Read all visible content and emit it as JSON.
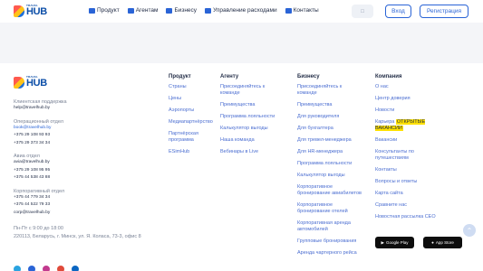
{
  "header": {
    "logo_small": "TRAVEL",
    "logo_big": "HUB",
    "nav": [
      "Продукт",
      "Агентам",
      "Бизнесу",
      "Управление расходами",
      "Контакты"
    ],
    "login": "Вход",
    "register": "Регистрация"
  },
  "contacts": {
    "support_label": "Клиентская поддержка",
    "support_email": "help@travelhub.by",
    "ops_label": "Операционный отдел",
    "ops_email": "book@travelhub.by",
    "ops_phone1": "+375 29 108 93 93",
    "ops_phone2": "+375 29 373 34 34",
    "avia_label": "Авиа отдел",
    "avia_email": "avia@travelhub.by",
    "avia_phone1": "+375 29 108 95 95",
    "avia_phone2": "+375 44 538 43 88",
    "corp_label": "Корпоративный отдел",
    "corp_phone1": "+375 44 779 34 34",
    "corp_phone2": "+375 44 522 79 33",
    "corp_email": "corp@travelhub.by",
    "hours": "Пн-Пт с 9:00 до 18:00",
    "address": "220113, Беларусь, г. Минск, ул. Я. Коласа, 73-3, офис 8"
  },
  "columns": {
    "product": {
      "title": "Продукт",
      "links": [
        "Страны",
        "Цены",
        "Аэропорты",
        "Медиапартнёрство",
        "Партнёрская программа",
        "ESimHub"
      ]
    },
    "agents": {
      "title": "Агенту",
      "links": [
        "Присоединяйтесь к команде",
        "Преимущества",
        "Программа лояльности",
        "Калькулятор выгоды",
        "Наша команда",
        "Вебинары в Live"
      ]
    },
    "business": {
      "title": "Бизнесу",
      "links": [
        "Присоединяйтесь к команде",
        "Преимущества",
        "Для руководителя",
        "Для бухгалтера",
        "Для тревел-менеджера",
        "Для HR-менеджера",
        "Программа лояльности",
        "Калькулятор выгоды",
        "Корпоративное бронирование авиабилетов",
        "Корпоративное бронирование отелей",
        "Корпоративная аренда автомобилей",
        "Групповые бронирования",
        "Аренда чартерного рейса"
      ]
    },
    "company": {
      "title": "Компания",
      "links": [
        "О нас",
        "Центр доверия",
        "Новости",
        "Карьера",
        "Вакансии",
        "Консультанты по путешествиям",
        "Контакты",
        "Вопросы и ответы",
        "Карта сайта",
        "Сравните нас",
        "Новостная рассылка CEO"
      ],
      "career_badge": "ОТКРЫТЫЕ ВАКАНСИИ"
    }
  },
  "stores": {
    "google": "Google Play",
    "apple": "App Store"
  },
  "colors": {
    "accent": "#2a64d6",
    "badge": "#ffe100"
  }
}
